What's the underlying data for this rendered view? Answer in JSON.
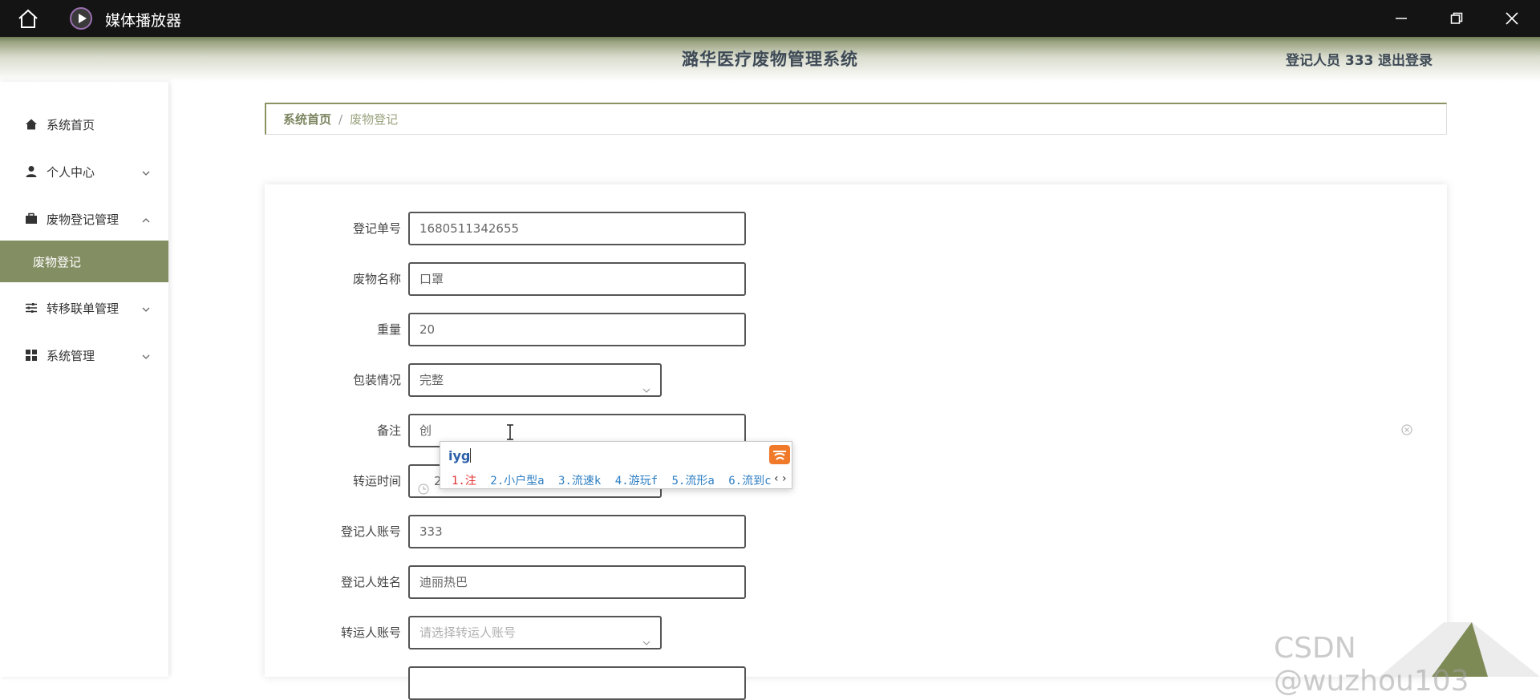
{
  "window": {
    "title": "媒体播放器"
  },
  "header": {
    "title": "潞华医疗废物管理系统",
    "user_label": "登记人员 333",
    "logout_label": "退出登录"
  },
  "sidebar": {
    "items": [
      {
        "label": "系统首页",
        "icon": "home-icon"
      },
      {
        "label": "个人中心",
        "icon": "user-icon"
      },
      {
        "label": "废物登记管理",
        "icon": "briefcase-icon"
      },
      {
        "label": "废物登记",
        "icon": ""
      },
      {
        "label": "转移联单管理",
        "icon": "sliders-icon"
      },
      {
        "label": "系统管理",
        "icon": "grid-icon"
      }
    ],
    "active_sub": "废物登记"
  },
  "breadcrumb": {
    "home": "系统首页",
    "separator": "/",
    "current": "废物登记"
  },
  "form": {
    "fields": [
      {
        "label": "登记单号",
        "value": "1680511342655"
      },
      {
        "label": "废物名称",
        "value": "口罩"
      },
      {
        "label": "重量",
        "value": "20"
      },
      {
        "label": "包装情况",
        "value": "完整"
      },
      {
        "label": "备注",
        "value": "创"
      },
      {
        "label": "转运时间",
        "value": "2"
      },
      {
        "label": "登记人账号",
        "value": "333"
      },
      {
        "label": "登记人姓名",
        "value": "迪丽热巴"
      },
      {
        "label": "转运人账号",
        "placeholder": "请选择转运人账号"
      }
    ]
  },
  "ime": {
    "input": "iyg",
    "candidates": [
      "1.注",
      "2.小户型a",
      "3.流速k",
      "4.游玩f",
      "5.流形a",
      "6.流到c"
    ],
    "nav": "‹ ›"
  },
  "watermark": "CSDN @wuzhou103",
  "colors": {
    "accent": "#838e62",
    "header_text": "#3e4a56",
    "titlebar": "#141414"
  }
}
